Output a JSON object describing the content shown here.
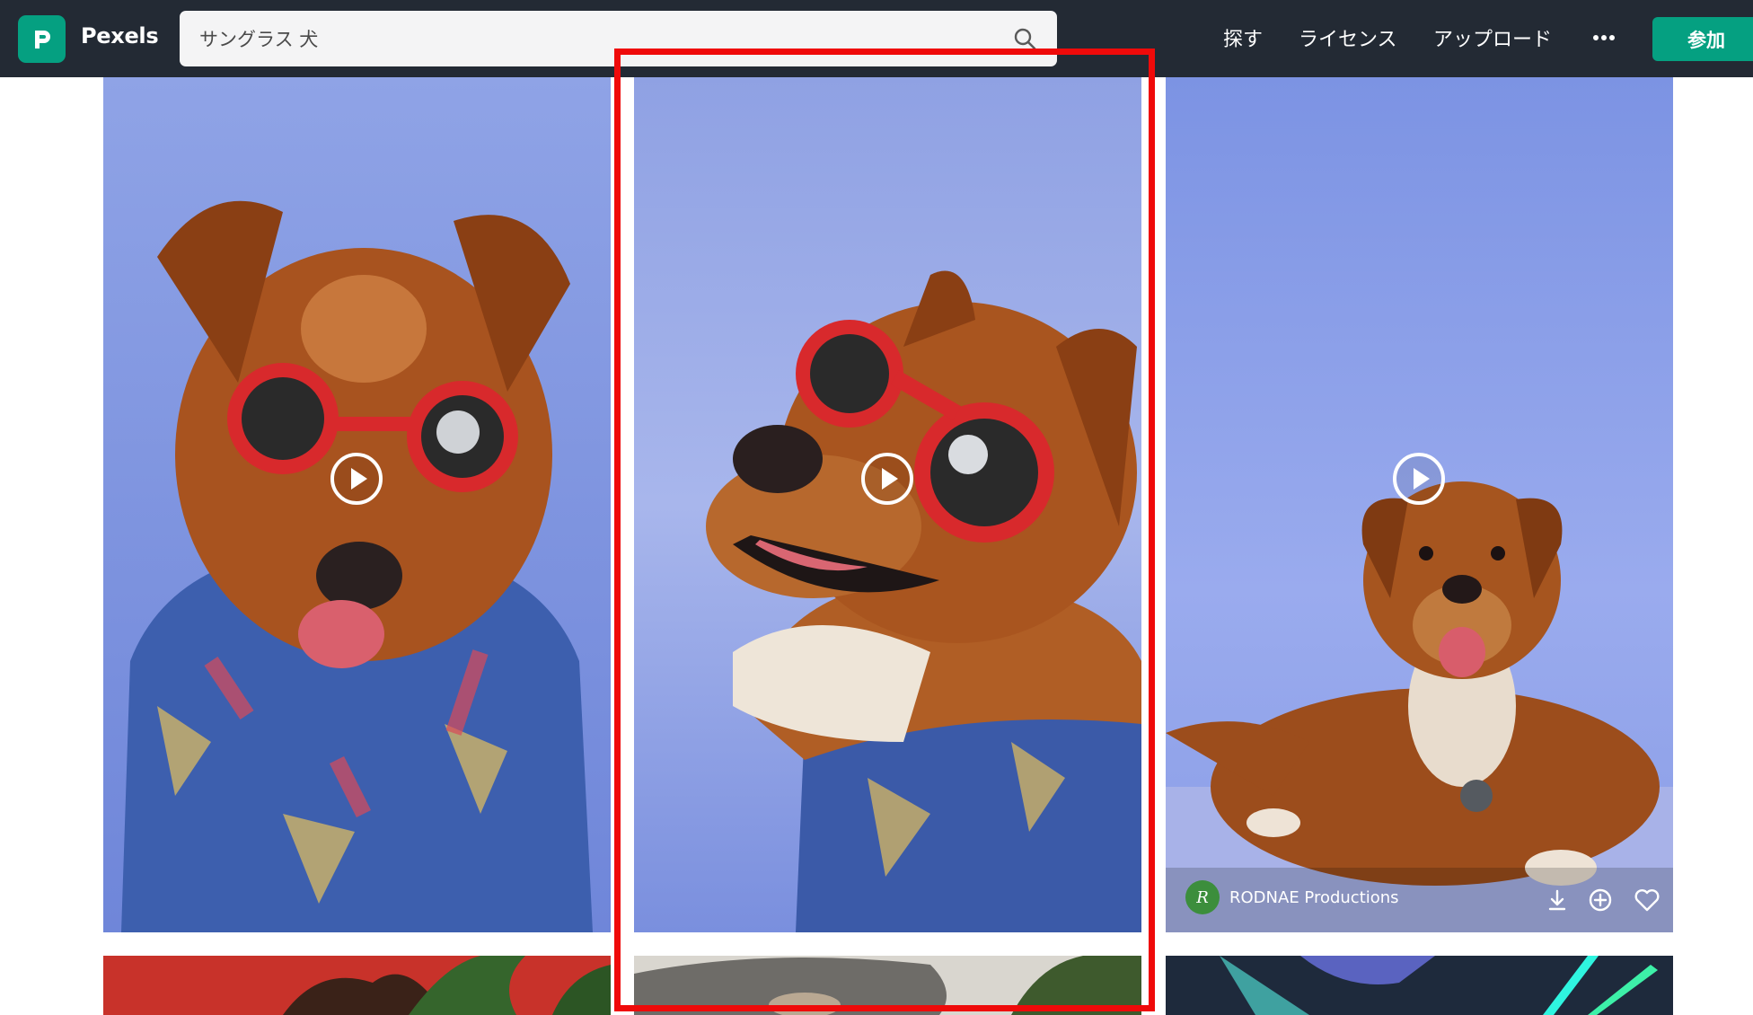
{
  "header": {
    "logo_text": "Pexels",
    "search_value": "サングラス 犬",
    "nav": [
      "探す",
      "ライセンス",
      "アップロード"
    ],
    "join_label": "参加"
  },
  "colors": {
    "topbar": "#232a34",
    "brand_green": "#05a081",
    "highlight": "#ef0a0a"
  },
  "results": [
    {
      "type": "video",
      "subject": "dog with red goggles and hawaiian shirt, facing camera"
    },
    {
      "type": "video",
      "subject": "dog with red goggles looking to side, open mouth"
    },
    {
      "type": "video",
      "subject": "dog lying on blue studio background",
      "author": "RODNAE Productions",
      "author_initial": "R",
      "actions": [
        "download-icon",
        "add-collection-icon",
        "like-icon"
      ]
    },
    {
      "type": "image",
      "subject": "dog on red background with plants"
    },
    {
      "type": "image",
      "subject": "grey pet bed with plant"
    },
    {
      "type": "image",
      "subject": "dog with neon lights"
    }
  ]
}
